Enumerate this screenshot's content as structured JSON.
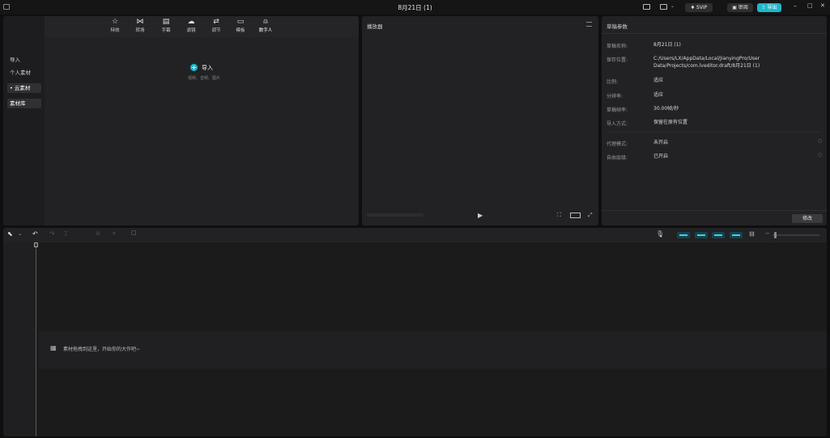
{
  "window": {
    "title": "8月21日 (1)"
  },
  "titlebar": {
    "vip_label": "SVIP",
    "review_label": "审阅",
    "export_label": "导出",
    "minimize_glyph": "–",
    "maximize_glyph": "□",
    "close_glyph": "✕"
  },
  "media": {
    "tools": [
      {
        "label": "特效",
        "icon": "star-icon",
        "glyph": "☆"
      },
      {
        "label": "转场",
        "icon": "transition-icon",
        "glyph": "⋈"
      },
      {
        "label": "字幕",
        "icon": "caption-icon",
        "glyph": "▤"
      },
      {
        "label": "滤镜",
        "icon": "filter-icon",
        "glyph": "☁"
      },
      {
        "label": "调节",
        "icon": "adjust-icon",
        "glyph": "⇄"
      },
      {
        "label": "模板",
        "icon": "template-icon",
        "glyph": "▭"
      },
      {
        "label": "数字人",
        "icon": "avatar-icon",
        "glyph": "⍝"
      }
    ],
    "sidebar": [
      {
        "label": "导入"
      },
      {
        "label": "个人素材"
      },
      {
        "label": "• 云素材"
      },
      {
        "label": "素材库"
      }
    ],
    "import_label": "导入",
    "import_hint": "视频、音频、图片"
  },
  "player": {
    "title": "播放器"
  },
  "params": {
    "title": "草稿参数",
    "rows": [
      {
        "label": "草稿名称:",
        "value": "8月21日 (1)"
      },
      {
        "label": "保存位置:",
        "value": "C:/Users/LX/AppData/Local/JianyingPro/User Data/Projects/com.lveditor.draft/8月21日 (1)"
      },
      {
        "label": "比例:",
        "value": "适应"
      },
      {
        "label": "分辨率:",
        "value": "适应"
      },
      {
        "label": "草稿帧率:",
        "value": "30.00帧/秒"
      },
      {
        "label": "导入方式:",
        "value": "保留在原有位置"
      },
      {
        "label": "代理模式:",
        "value": "未开启"
      },
      {
        "label": "自由层级:",
        "value": "已开启"
      }
    ],
    "edit_label": "修改"
  },
  "timeline": {
    "drop_hint": "素材拖拽到这里，开始你的大作吧~"
  },
  "colors": {
    "accent": "#1fb6c9",
    "panel": "#222224",
    "background": "#0f0f10"
  }
}
